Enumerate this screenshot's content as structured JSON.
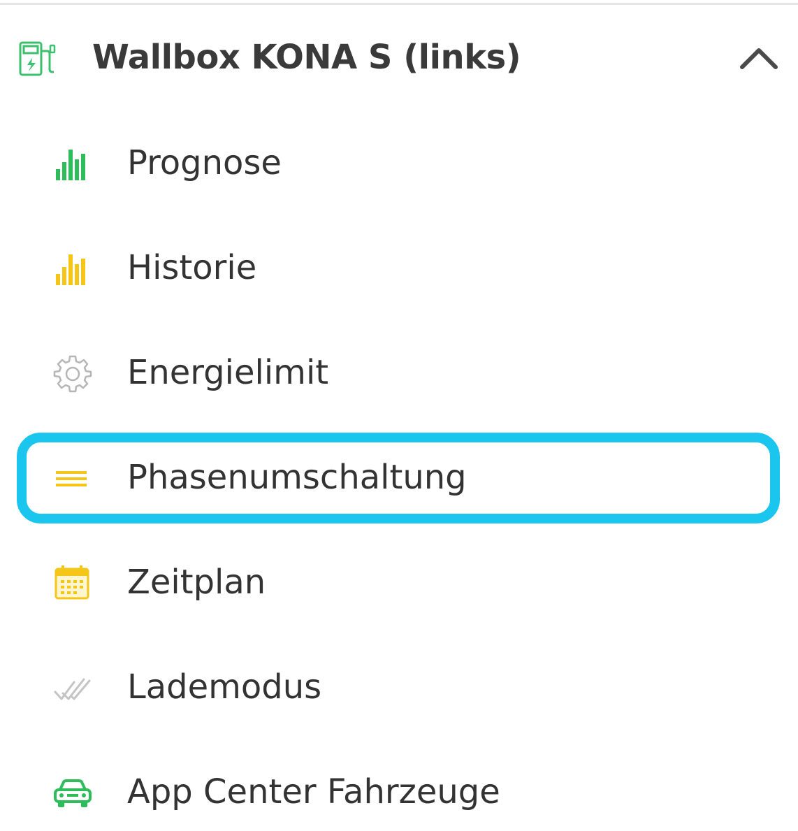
{
  "section": {
    "title": "Wallbox KONA S (links)",
    "icon": "wallbox-charger-icon",
    "toggle_icon": "chevron-up-icon",
    "expanded": true,
    "icon_color": "#3cbf6e"
  },
  "menu": {
    "items": [
      {
        "label": "Prognose",
        "icon": "bar-chart-icon",
        "icon_color": "#2ebd5a"
      },
      {
        "label": "Historie",
        "icon": "bar-chart-icon",
        "icon_color": "#f5c518"
      },
      {
        "label": "Energielimit",
        "icon": "gear-icon",
        "icon_color": "#b5b5b5"
      },
      {
        "label": "Phasenumschaltung",
        "icon": "three-lines-icon",
        "icon_color": "#f5c518",
        "highlighted": true
      },
      {
        "label": "Zeitplan",
        "icon": "calendar-icon",
        "icon_color": "#f5c518"
      },
      {
        "label": "Lademodus",
        "icon": "double-check-icon",
        "icon_color": "#c4c4c4"
      },
      {
        "label": "App Center Fahrzeuge",
        "icon": "car-icon",
        "icon_color": "#2ebd5a"
      }
    ]
  },
  "colors": {
    "highlight_border": "#1bc6ee",
    "text": "#333333",
    "divider": "#e6e6e6"
  }
}
